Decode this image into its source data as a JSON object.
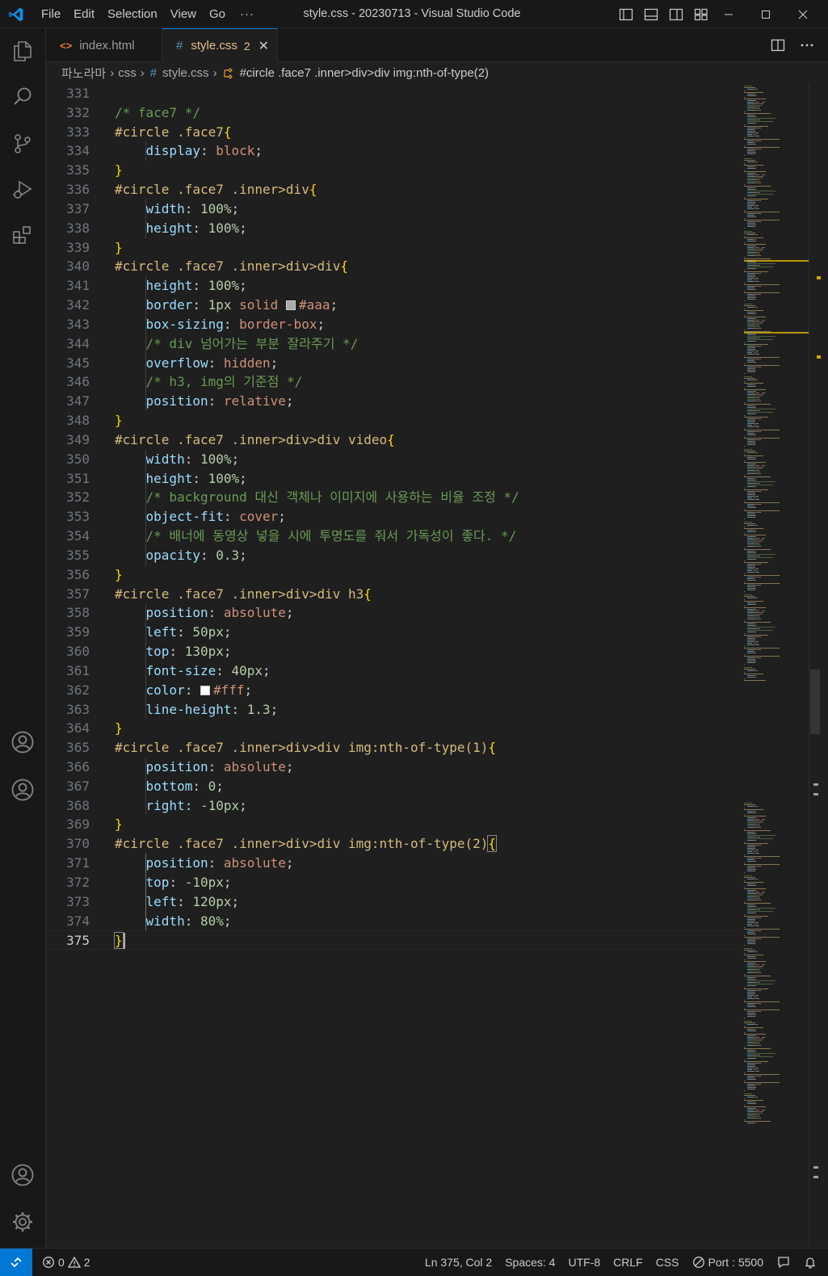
{
  "window": {
    "title": "style.css - 20230713 - Visual Studio Code",
    "menu": [
      "File",
      "Edit",
      "Selection",
      "View",
      "Go"
    ],
    "menu_more": "···"
  },
  "tabs": [
    {
      "label": "index.html",
      "icon": "html-file-icon"
    },
    {
      "label": "style.css",
      "icon": "css-file-icon",
      "badge": "2",
      "active": true
    }
  ],
  "breadcrumb": {
    "folder": "파노라마",
    "subfolder": "css",
    "file": "style.css",
    "symbol": "#circle .face7 .inner>div>div img:nth-of-type(2)"
  },
  "editor": {
    "lines": [
      {
        "n": "331",
        "tokens": []
      },
      {
        "n": "332",
        "tokens": [
          [
            "c-com",
            "/* face7 */"
          ]
        ]
      },
      {
        "n": "333",
        "tokens": [
          [
            "c-sel",
            "#circle .face7"
          ],
          [
            "c-br",
            "{"
          ]
        ]
      },
      {
        "n": "334",
        "tokens": [
          [
            "c-pun",
            "    "
          ],
          [
            "c-prop",
            "display"
          ],
          [
            "c-pun",
            ": "
          ],
          [
            "c-val",
            "block"
          ],
          [
            "c-pun",
            ";"
          ]
        ]
      },
      {
        "n": "335",
        "tokens": [
          [
            "c-br",
            "}"
          ]
        ]
      },
      {
        "n": "336",
        "tokens": [
          [
            "c-sel",
            "#circle .face7 .inner>div"
          ],
          [
            "c-br",
            "{"
          ]
        ]
      },
      {
        "n": "337",
        "tokens": [
          [
            "c-pun",
            "    "
          ],
          [
            "c-prop",
            "width"
          ],
          [
            "c-pun",
            ": "
          ],
          [
            "c-num",
            "100%"
          ],
          [
            "c-pun",
            ";"
          ]
        ]
      },
      {
        "n": "338",
        "tokens": [
          [
            "c-pun",
            "    "
          ],
          [
            "c-prop",
            "height"
          ],
          [
            "c-pun",
            ": "
          ],
          [
            "c-num",
            "100%"
          ],
          [
            "c-pun",
            ";"
          ]
        ]
      },
      {
        "n": "339",
        "tokens": [
          [
            "c-br",
            "}"
          ]
        ]
      },
      {
        "n": "340",
        "tokens": [
          [
            "c-sel",
            "#circle .face7 .inner>div>div"
          ],
          [
            "c-br",
            "{"
          ]
        ]
      },
      {
        "n": "341",
        "tokens": [
          [
            "c-pun",
            "    "
          ],
          [
            "c-prop",
            "height"
          ],
          [
            "c-pun",
            ": "
          ],
          [
            "c-num",
            "100%"
          ],
          [
            "c-pun",
            ";"
          ]
        ]
      },
      {
        "n": "342",
        "tokens": [
          [
            "c-pun",
            "    "
          ],
          [
            "c-prop",
            "border"
          ],
          [
            "c-pun",
            ": "
          ],
          [
            "c-num",
            "1px"
          ],
          [
            "c-pun",
            " "
          ],
          [
            "c-val",
            "solid"
          ],
          [
            "c-pun",
            " "
          ],
          [
            "swatch",
            "#aaaaaa"
          ],
          [
            "c-val",
            "#aaa"
          ],
          [
            "c-pun",
            ";"
          ]
        ]
      },
      {
        "n": "343",
        "tokens": [
          [
            "c-pun",
            "    "
          ],
          [
            "c-prop",
            "box-sizing"
          ],
          [
            "c-pun",
            ": "
          ],
          [
            "c-val",
            "border-box"
          ],
          [
            "c-pun",
            ";"
          ]
        ]
      },
      {
        "n": "344",
        "tokens": [
          [
            "c-pun",
            "    "
          ],
          [
            "c-com",
            "/* div 넘어가는 부분 잘라주기 */"
          ]
        ]
      },
      {
        "n": "345",
        "tokens": [
          [
            "c-pun",
            "    "
          ],
          [
            "c-prop",
            "overflow"
          ],
          [
            "c-pun",
            ": "
          ],
          [
            "c-val",
            "hidden"
          ],
          [
            "c-pun",
            ";"
          ]
        ]
      },
      {
        "n": "346",
        "tokens": [
          [
            "c-pun",
            "    "
          ],
          [
            "c-com",
            "/* h3, img의 기준점 */"
          ]
        ]
      },
      {
        "n": "347",
        "tokens": [
          [
            "c-pun",
            "    "
          ],
          [
            "c-prop",
            "position"
          ],
          [
            "c-pun",
            ": "
          ],
          [
            "c-val",
            "relative"
          ],
          [
            "c-pun",
            ";"
          ]
        ]
      },
      {
        "n": "348",
        "tokens": [
          [
            "c-br",
            "}"
          ]
        ]
      },
      {
        "n": "349",
        "tokens": [
          [
            "c-sel",
            "#circle .face7 .inner>div>div video"
          ],
          [
            "c-br",
            "{"
          ]
        ]
      },
      {
        "n": "350",
        "tokens": [
          [
            "c-pun",
            "    "
          ],
          [
            "c-prop",
            "width"
          ],
          [
            "c-pun",
            ": "
          ],
          [
            "c-num",
            "100%"
          ],
          [
            "c-pun",
            ";"
          ]
        ]
      },
      {
        "n": "351",
        "tokens": [
          [
            "c-pun",
            "    "
          ],
          [
            "c-prop",
            "height"
          ],
          [
            "c-pun",
            ": "
          ],
          [
            "c-num",
            "100%"
          ],
          [
            "c-pun",
            ";"
          ]
        ]
      },
      {
        "n": "352",
        "tokens": [
          [
            "c-pun",
            "    "
          ],
          [
            "c-com",
            "/* background 대신 객체나 이미지에 사용하는 비율 조정 */"
          ]
        ]
      },
      {
        "n": "353",
        "tokens": [
          [
            "c-pun",
            "    "
          ],
          [
            "c-prop",
            "object-fit"
          ],
          [
            "c-pun",
            ": "
          ],
          [
            "c-val",
            "cover"
          ],
          [
            "c-pun",
            ";"
          ]
        ]
      },
      {
        "n": "354",
        "tokens": [
          [
            "c-pun",
            "    "
          ],
          [
            "c-com",
            "/* 배너에 동영상 넣을 시에 투명도를 줘서 가독성이 좋다. */"
          ]
        ]
      },
      {
        "n": "355",
        "tokens": [
          [
            "c-pun",
            "    "
          ],
          [
            "c-prop",
            "opacity"
          ],
          [
            "c-pun",
            ": "
          ],
          [
            "c-num",
            "0.3"
          ],
          [
            "c-pun",
            ";"
          ]
        ]
      },
      {
        "n": "356",
        "tokens": [
          [
            "c-br",
            "}"
          ]
        ]
      },
      {
        "n": "357",
        "tokens": [
          [
            "c-sel",
            "#circle .face7 .inner>div>div h3"
          ],
          [
            "c-br",
            "{"
          ]
        ]
      },
      {
        "n": "358",
        "tokens": [
          [
            "c-pun",
            "    "
          ],
          [
            "c-prop",
            "position"
          ],
          [
            "c-pun",
            ": "
          ],
          [
            "c-val",
            "absolute"
          ],
          [
            "c-pun",
            ";"
          ]
        ]
      },
      {
        "n": "359",
        "tokens": [
          [
            "c-pun",
            "    "
          ],
          [
            "c-prop",
            "left"
          ],
          [
            "c-pun",
            ": "
          ],
          [
            "c-num",
            "50px"
          ],
          [
            "c-pun",
            ";"
          ]
        ]
      },
      {
        "n": "360",
        "tokens": [
          [
            "c-pun",
            "    "
          ],
          [
            "c-prop",
            "top"
          ],
          [
            "c-pun",
            ": "
          ],
          [
            "c-num",
            "130px"
          ],
          [
            "c-pun",
            ";"
          ]
        ]
      },
      {
        "n": "361",
        "tokens": [
          [
            "c-pun",
            "    "
          ],
          [
            "c-prop",
            "font-size"
          ],
          [
            "c-pun",
            ": "
          ],
          [
            "c-num",
            "40px"
          ],
          [
            "c-pun",
            ";"
          ]
        ]
      },
      {
        "n": "362",
        "tokens": [
          [
            "c-pun",
            "    "
          ],
          [
            "c-prop",
            "color"
          ],
          [
            "c-pun",
            ": "
          ],
          [
            "swatch",
            "#ffffff"
          ],
          [
            "c-val",
            "#fff"
          ],
          [
            "c-pun",
            ";"
          ]
        ]
      },
      {
        "n": "363",
        "tokens": [
          [
            "c-pun",
            "    "
          ],
          [
            "c-prop",
            "line-height"
          ],
          [
            "c-pun",
            ": "
          ],
          [
            "c-num",
            "1.3"
          ],
          [
            "c-pun",
            ";"
          ]
        ]
      },
      {
        "n": "364",
        "tokens": [
          [
            "c-br",
            "}"
          ]
        ]
      },
      {
        "n": "365",
        "tokens": [
          [
            "c-sel",
            "#circle .face7 .inner>div>div img:nth-of-type(1)"
          ],
          [
            "c-br",
            "{"
          ]
        ]
      },
      {
        "n": "366",
        "tokens": [
          [
            "c-pun",
            "    "
          ],
          [
            "c-prop",
            "position"
          ],
          [
            "c-pun",
            ": "
          ],
          [
            "c-val",
            "absolute"
          ],
          [
            "c-pun",
            ";"
          ]
        ]
      },
      {
        "n": "367",
        "tokens": [
          [
            "c-pun",
            "    "
          ],
          [
            "c-prop",
            "bottom"
          ],
          [
            "c-pun",
            ": "
          ],
          [
            "c-num",
            "0"
          ],
          [
            "c-pun",
            ";"
          ]
        ]
      },
      {
        "n": "368",
        "tokens": [
          [
            "c-pun",
            "    "
          ],
          [
            "c-prop",
            "right"
          ],
          [
            "c-pun",
            ": "
          ],
          [
            "c-num",
            "-10px"
          ],
          [
            "c-pun",
            ";"
          ]
        ]
      },
      {
        "n": "369",
        "tokens": [
          [
            "c-br",
            "}"
          ]
        ]
      },
      {
        "n": "370",
        "tokens": [
          [
            "c-sel",
            "#circle .face7 .inner>div>div img:nth-of-type(2)"
          ],
          [
            "bm",
            "{"
          ]
        ]
      },
      {
        "n": "371",
        "tokens": [
          [
            "c-pun",
            "    "
          ],
          [
            "c-prop",
            "position"
          ],
          [
            "c-pun",
            ": "
          ],
          [
            "c-val",
            "absolute"
          ],
          [
            "c-pun",
            ";"
          ]
        ]
      },
      {
        "n": "372",
        "tokens": [
          [
            "c-pun",
            "    "
          ],
          [
            "c-prop",
            "top"
          ],
          [
            "c-pun",
            ": "
          ],
          [
            "c-num",
            "-10px"
          ],
          [
            "c-pun",
            ";"
          ]
        ]
      },
      {
        "n": "373",
        "tokens": [
          [
            "c-pun",
            "    "
          ],
          [
            "c-prop",
            "left"
          ],
          [
            "c-pun",
            ": "
          ],
          [
            "c-num",
            "120px"
          ],
          [
            "c-pun",
            ";"
          ]
        ]
      },
      {
        "n": "374",
        "tokens": [
          [
            "c-pun",
            "    "
          ],
          [
            "c-prop",
            "width"
          ],
          [
            "c-pun",
            ": "
          ],
          [
            "c-num",
            "80%"
          ],
          [
            "c-pun",
            ";"
          ]
        ]
      },
      {
        "n": "375",
        "tokens": [
          [
            "bm",
            "}"
          ]
        ],
        "current": true
      }
    ]
  },
  "status": {
    "errors": "0",
    "warnings": "2",
    "position": "Ln 375, Col 2",
    "spaces": "Spaces: 4",
    "encoding": "UTF-8",
    "eol": "CRLF",
    "language": "CSS",
    "port": "Port : 5500"
  },
  "colors": {
    "accent": "#0078d4",
    "comment": "#6a9955",
    "selector": "#d7ba7d",
    "bracket": "#ffd700",
    "property": "#9cdcfe",
    "value": "#ce9178",
    "number": "#b5cea8"
  }
}
